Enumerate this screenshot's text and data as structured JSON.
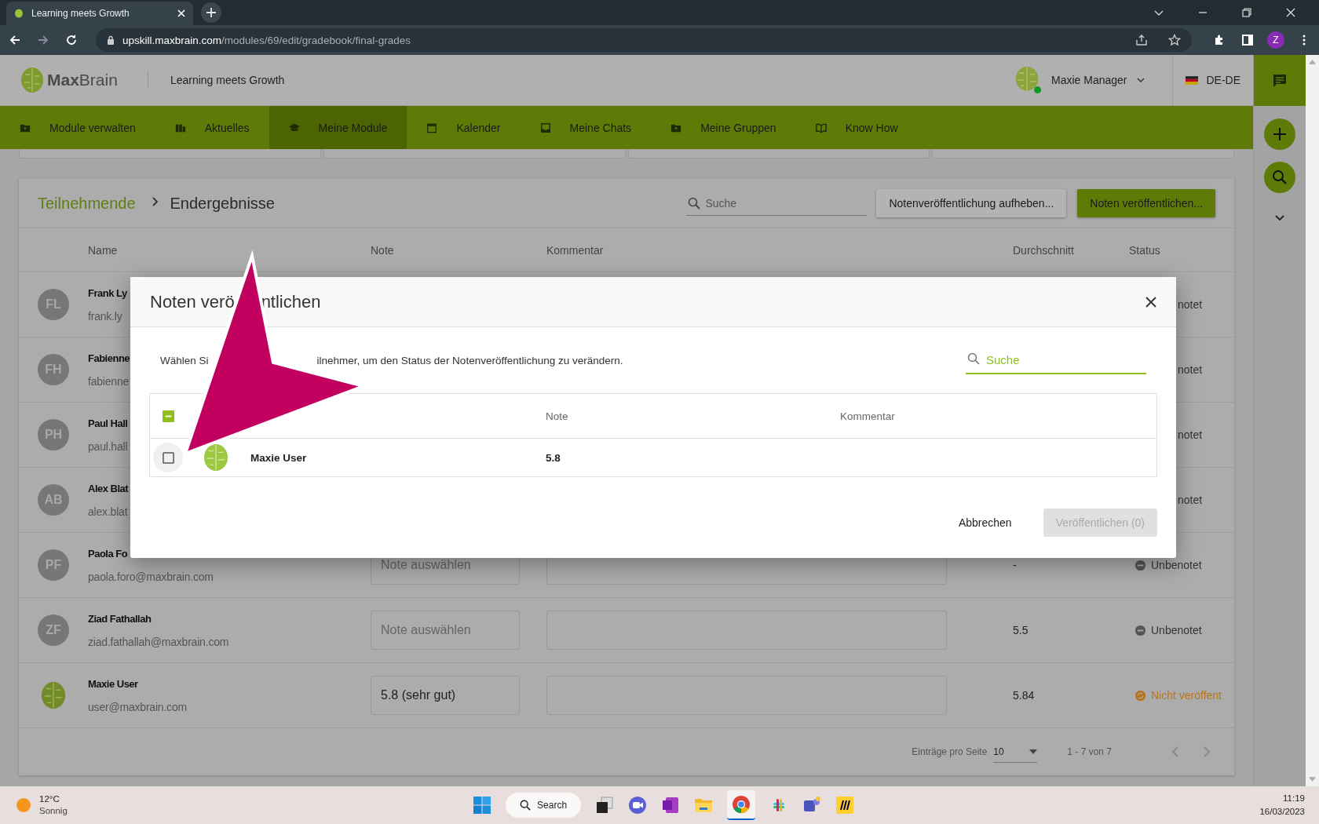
{
  "browser": {
    "tab_title": "Learning meets Growth",
    "url_host": "upskill.maxbrain.com",
    "url_path": "/modules/69/edit/gradebook/final-grades",
    "profile_initial": "Z"
  },
  "header": {
    "logo_bold": "Max",
    "logo_light": "Brain",
    "tagline": "Learning meets Growth",
    "user_name": "Maxie Manager",
    "online": true,
    "language": "DE-DE"
  },
  "nav": [
    {
      "label": "Module verwalten",
      "selected": false
    },
    {
      "label": "Aktuelles",
      "selected": false
    },
    {
      "label": "Meine Module",
      "selected": true
    },
    {
      "label": "Kalender",
      "selected": false
    },
    {
      "label": "Meine Chats",
      "selected": false
    },
    {
      "label": "Meine Gruppen",
      "selected": false
    },
    {
      "label": "Know How",
      "selected": false
    }
  ],
  "card": {
    "breadcrumb": {
      "link": "Teilnehmende",
      "current": "Endergebnisse"
    },
    "search": {
      "placeholder": "Suche"
    },
    "buttons": [
      {
        "label": "Notenveröffentlichung aufheben...",
        "kind": "secondary"
      },
      {
        "label": "Noten veröffentlichen...",
        "kind": "primary"
      }
    ],
    "columns": [
      "Name",
      "Note",
      "Kommentar",
      "Durchschnitt",
      "Status"
    ],
    "rows": [
      {
        "initials": "FL",
        "name": "Frank Ly",
        "email": "frank.ly",
        "status": "notet"
      },
      {
        "initials": "FH",
        "name": "Fabienne",
        "email": "fabienne",
        "status": "notet"
      },
      {
        "initials": "PH",
        "name": "Paul Hall",
        "email": "paul.hall",
        "status": "notet"
      },
      {
        "initials": "AB",
        "name": "Alex Blat",
        "email": "alex.blat",
        "status": "notet"
      },
      {
        "initials": "PF",
        "name": "Paola Fo",
        "email": "paola.foro@maxbrain.com",
        "grade_placeholder": "Note auswählen",
        "average": "-",
        "status": "Unbenotet",
        "kind": "ungraded"
      },
      {
        "initials": "ZF",
        "name": "Ziad Fathallah",
        "email": "ziad.fathallah@maxbrain.com",
        "grade_placeholder": "Note auswählen",
        "average": "5.5",
        "status": "Unbenotet",
        "kind": "ungraded"
      },
      {
        "name": "Maxie User",
        "email": "user@maxbrain.com",
        "grade": "5.8 (sehr gut)",
        "average": "5.84",
        "status": "Nicht veröffent",
        "kind": "unpublished"
      }
    ],
    "pagination": {
      "per_page_label": "Einträge pro Seite",
      "per_page": "10",
      "range": "1 - 7 von 7"
    }
  },
  "dialog": {
    "title_parts": [
      "Noten verö",
      "ntlichen"
    ],
    "instruction_parts": [
      "Wählen Si",
      "ilnehmer, um den Status der Notenveröffentlichung zu verändern."
    ],
    "search": {
      "placeholder": "Suche",
      "focused": true
    },
    "select_all": {
      "indeterminate": true
    },
    "columns": [
      "Note",
      "Kommentar"
    ],
    "rows": [
      {
        "checked": false,
        "name": "Maxie User",
        "grade": "5.8"
      }
    ],
    "buttons": [
      {
        "label": "Abbrechen",
        "kind": "text",
        "disabled": false
      },
      {
        "label": "Veröffentlichen (0)",
        "kind": "filled",
        "disabled": true
      }
    ]
  },
  "taskbar": {
    "weather_temp": "12°C",
    "weather_text": "Sonnig",
    "search": "Search",
    "time": "11:19",
    "date": "16/03/2023"
  }
}
